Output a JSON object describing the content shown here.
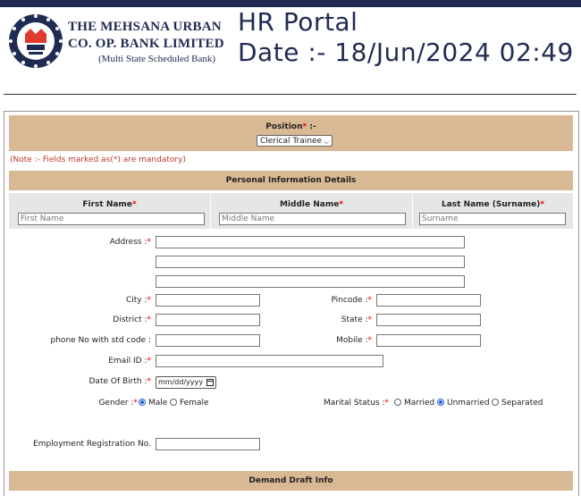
{
  "header": {
    "bank_line1": "THE MEHSANA URBAN",
    "bank_line2": "CO. OP. BANK LIMITED",
    "bank_line3": "(Multi State Scheduled Bank)",
    "portal_title": "HR Portal",
    "portal_date": "Date :- 18/Jun/2024 02:49",
    "logo_text": "THE MEHSANA URBAN CO-OP BANK LTD.",
    "brand_color": "#1f2b52",
    "logo_accent": "#e03a2e"
  },
  "position": {
    "label": "Position",
    "required_mark": "*",
    "suffix": " :-",
    "selected": "Clerical Trainee"
  },
  "note": "(Note :- Fields marked as(*) are mandatory)",
  "sections": {
    "personal": "Personal Information Details",
    "demand_draft": "Demand Draft Info"
  },
  "name_fields": {
    "first_label": "First Name",
    "first_placeholder": "First Name",
    "middle_label": "Middle Name",
    "middle_placeholder": "Middle Name",
    "last_label": "Last Name (Surname)",
    "last_placeholder": "Surname"
  },
  "labels": {
    "address": "Address :",
    "city": "City :",
    "pincode": "Pincode :",
    "district": "District :",
    "state": "State :",
    "phone": "phone No with std code :",
    "mobile": "Mobile :",
    "email": "Email ID :",
    "dob": "Date Of Birth :",
    "gender": "Gender :",
    "marital": "Marital Status :",
    "employment": "Employment Registration No."
  },
  "dob_placeholder": "mm/dd/yyyy",
  "gender_options": [
    "Male",
    "Female"
  ],
  "gender_selected": "Male",
  "marital_options": [
    "Married",
    "Unmarried",
    "Separated"
  ],
  "marital_selected": "Unmarried",
  "colors": {
    "section_band": "#d8b994",
    "name_grid": "#e6e6e6",
    "required": "#e00000",
    "note": "#c0392b",
    "radio_selected": "#1a5fd6"
  }
}
